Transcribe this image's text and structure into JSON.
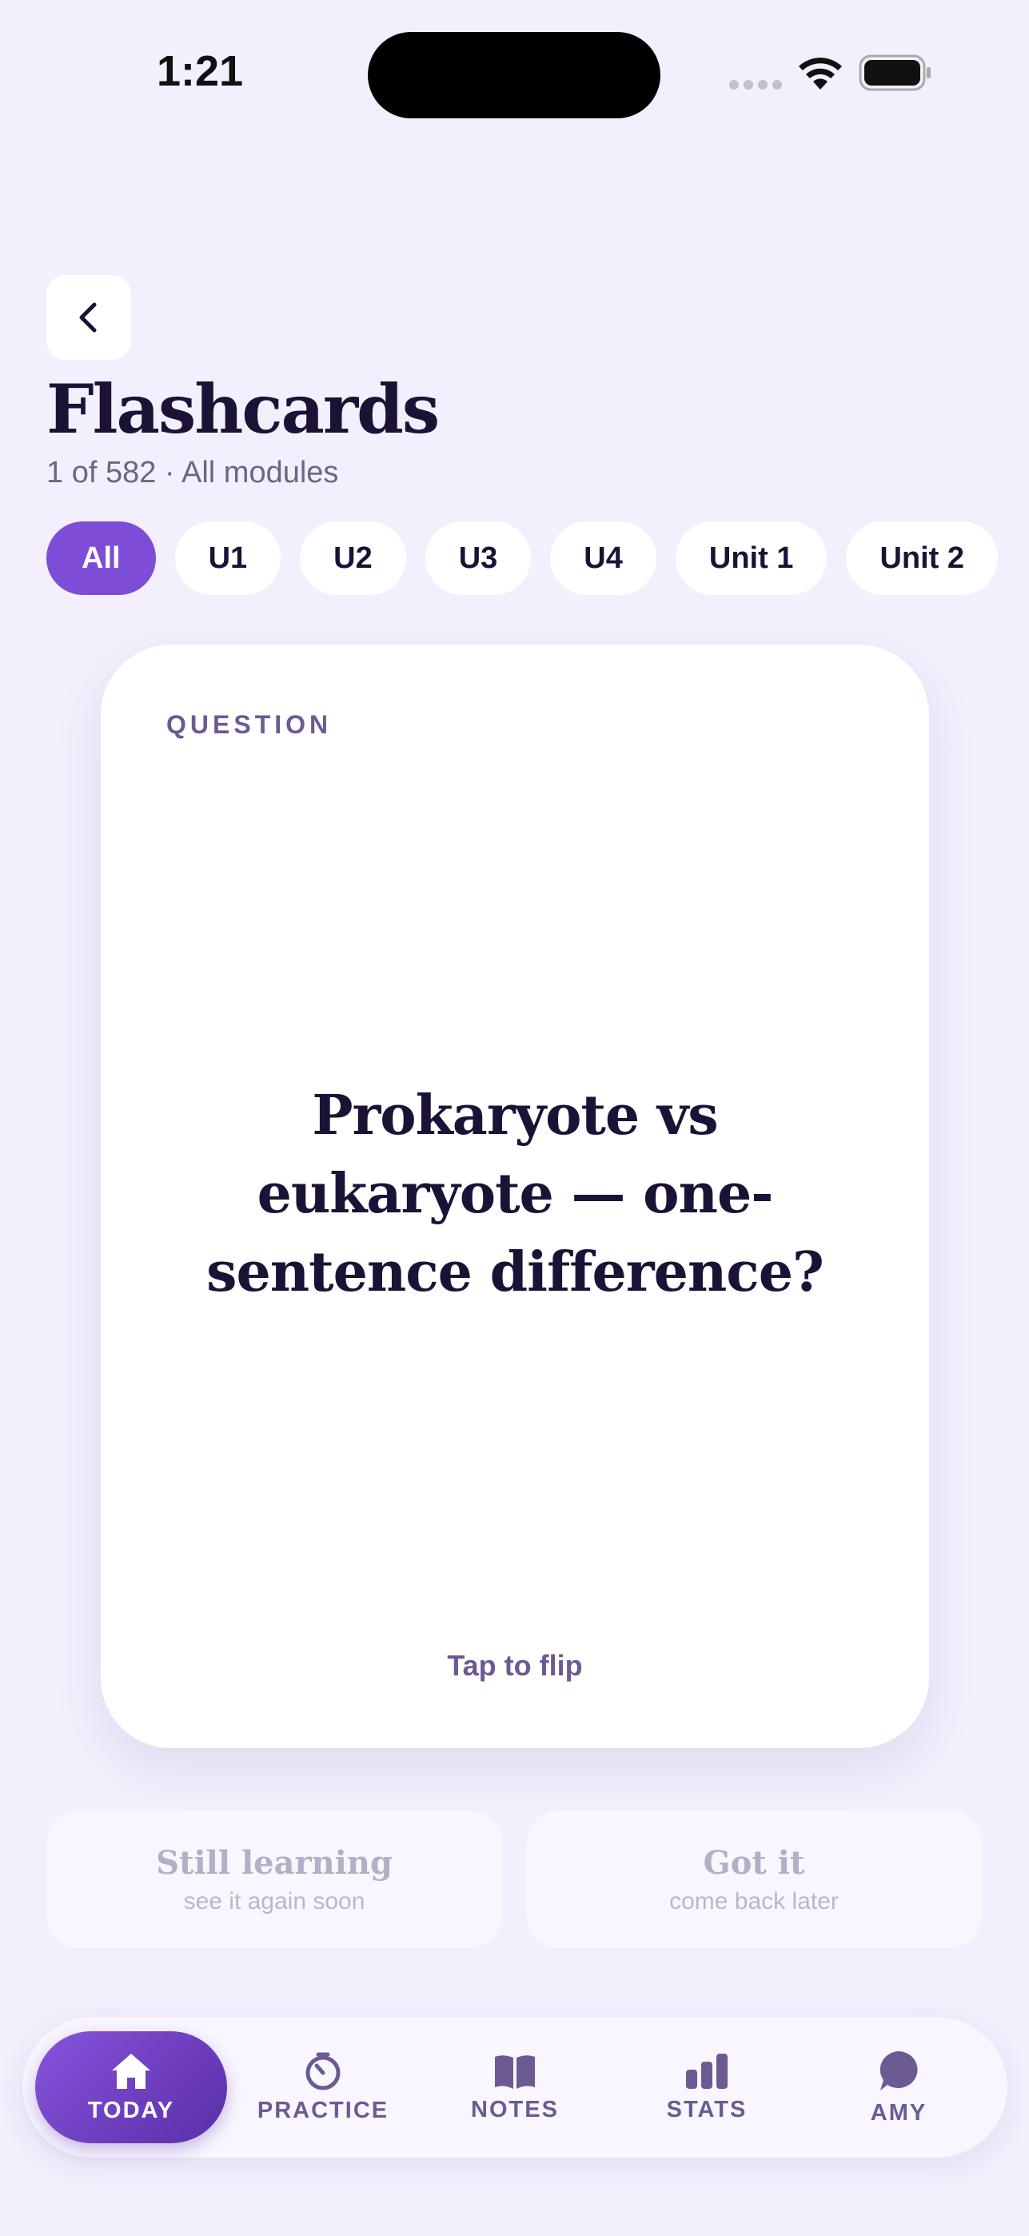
{
  "status_bar": {
    "time": "1:21"
  },
  "header": {
    "title": "Flashcards",
    "subtitle": "1 of 582 · All modules"
  },
  "filters": {
    "chips": [
      "All",
      "U1",
      "U2",
      "U3",
      "U4",
      "Unit 1",
      "Unit 2"
    ],
    "selected": "All"
  },
  "card": {
    "label": "QUESTION",
    "question": "Prokaryote vs eukaryote — one-sentence difference?",
    "hint": "Tap to flip"
  },
  "answers": {
    "still_learning": {
      "label": "Still learning",
      "sub": "see it again soon"
    },
    "got_it": {
      "label": "Got it",
      "sub": "come back later"
    }
  },
  "tabbar": {
    "items": [
      {
        "label": "TODAY",
        "icon": "home-icon"
      },
      {
        "label": "PRACTICE",
        "icon": "timer-icon"
      },
      {
        "label": "NOTES",
        "icon": "book-icon"
      },
      {
        "label": "STATS",
        "icon": "bar-chart-icon"
      },
      {
        "label": "AMY",
        "icon": "chat-bubble-icon"
      }
    ],
    "active": "TODAY"
  },
  "colors": {
    "background": "#f3effc",
    "accent": "#7d4dd8",
    "text_primary": "#1c1236",
    "text_secondary": "#6c5a93"
  }
}
